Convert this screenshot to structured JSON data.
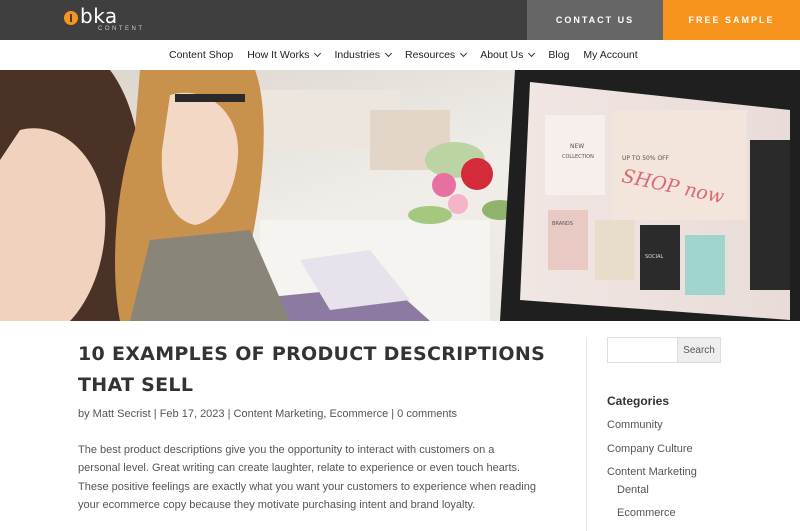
{
  "header": {
    "logo_word": "bka",
    "logo_sub": "CONTENT",
    "contact_label": "CONTACT US",
    "sample_label": "FREE SAMPLE"
  },
  "nav": {
    "items": [
      {
        "label": "Content Shop",
        "dropdown": false
      },
      {
        "label": "How It Works",
        "dropdown": true
      },
      {
        "label": "Industries",
        "dropdown": true
      },
      {
        "label": "Resources",
        "dropdown": true
      },
      {
        "label": "About Us",
        "dropdown": true
      },
      {
        "label": "Blog",
        "dropdown": false
      },
      {
        "label": "My Account",
        "dropdown": false
      }
    ]
  },
  "hero": {
    "screen_new": "NEW",
    "screen_collection": "COLLECTION",
    "screen_shop": "SHOP now",
    "screen_sale": "UP TO 50% OFF",
    "screen_brands": "BRANDS",
    "screen_social": "SOCIAL"
  },
  "post": {
    "title_line1": "10 EXAMPLES OF PRODUCT DESCRIPTIONS",
    "title_line2": "THAT SELL",
    "meta": "by Matt Secrist | Feb 17, 2023 | Content Marketing, Ecommerce | 0 comments",
    "intro_lines": [
      "The best product descriptions give you the opportunity to interact with customers on a",
      "personal level. Great writing can create laughter, relate to experience or even touch hearts.",
      "These positive feelings are exactly what you want your customers to experience when reading",
      "your ecommerce copy because they motivate purchasing intent and brand loyalty."
    ]
  },
  "sidebar": {
    "search_placeholder": "",
    "search_button": "Search",
    "categories_heading": "Categories",
    "categories": [
      "Community",
      "Company Culture",
      "Content Marketing",
      "Dental",
      "Ecommerce"
    ]
  },
  "colors": {
    "topbar": "#3f3f3f",
    "accent": "#f7941d",
    "contact_bg": "#666666"
  }
}
